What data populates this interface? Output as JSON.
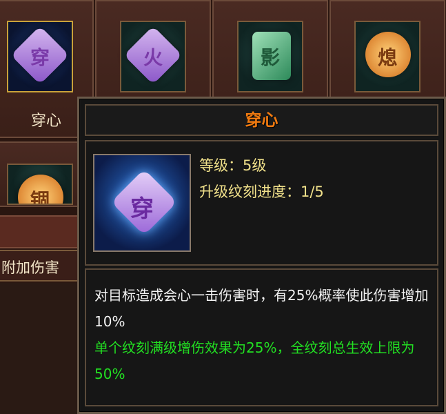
{
  "grid": {
    "slots": [
      {
        "label": "穿心",
        "glyph": "穿",
        "color": "purple",
        "selected": true
      },
      {
        "label": "",
        "glyph": "火",
        "color": "purple",
        "selected": false
      },
      {
        "label": "",
        "glyph": "影",
        "color": "green",
        "selected": false
      },
      {
        "label": "",
        "glyph": "熄",
        "color": "orange",
        "selected": false
      },
      {
        "label": "",
        "glyph": "锢",
        "color": "orange",
        "selected": false
      }
    ]
  },
  "left_panel": {
    "attr_label": "附加伤害"
  },
  "tooltip": {
    "title": "穿心",
    "icon_glyph": "穿",
    "level_text": "等级：5级",
    "progress_text": "升级纹刻进度：1/5",
    "description": "对目标造成会心一击伤害时，有25%概率使此伤害增加10%",
    "note": "单个纹刻满级增伤效果为25%，全纹刻总生效上限为50%"
  },
  "colors": {
    "title": "#f07a10",
    "stats": "#f0e08a",
    "desc": "#f2f2f2",
    "note": "#22e022"
  }
}
